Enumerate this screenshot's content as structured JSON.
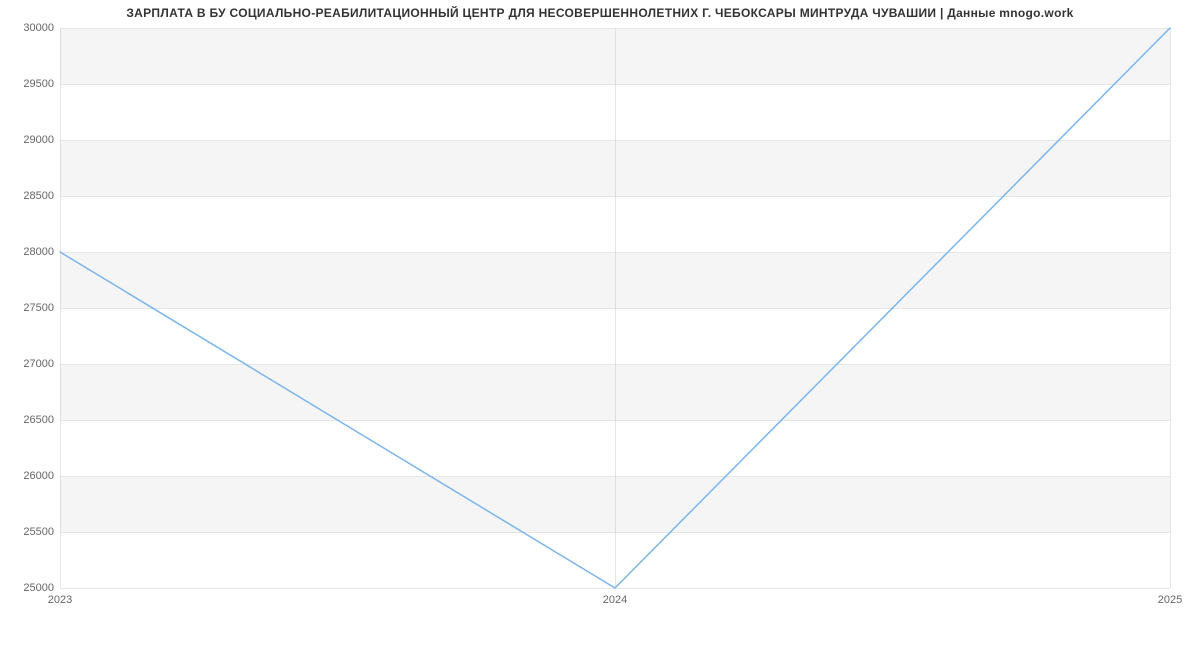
{
  "chart_data": {
    "type": "line",
    "title": "ЗАРПЛАТА В БУ СОЦИАЛЬНО-РЕАБИЛИТАЦИОННЫЙ ЦЕНТР ДЛЯ НЕСОВЕРШЕННОЛЕТНИХ Г. ЧЕБОКСАРЫ МИНТРУДА ЧУВАШИИ | Данные mnogo.work",
    "x": [
      2023,
      2024,
      2025
    ],
    "values": [
      28000,
      25000,
      30000
    ],
    "x_ticks": [
      2023,
      2024,
      2025
    ],
    "y_ticks": [
      25000,
      25500,
      26000,
      26500,
      27000,
      27500,
      28000,
      28500,
      29000,
      29500,
      30000
    ],
    "ylim": [
      25000,
      30000
    ],
    "xlim": [
      2023,
      2025
    ],
    "series_color": "#7cb5ec",
    "grid": true
  }
}
